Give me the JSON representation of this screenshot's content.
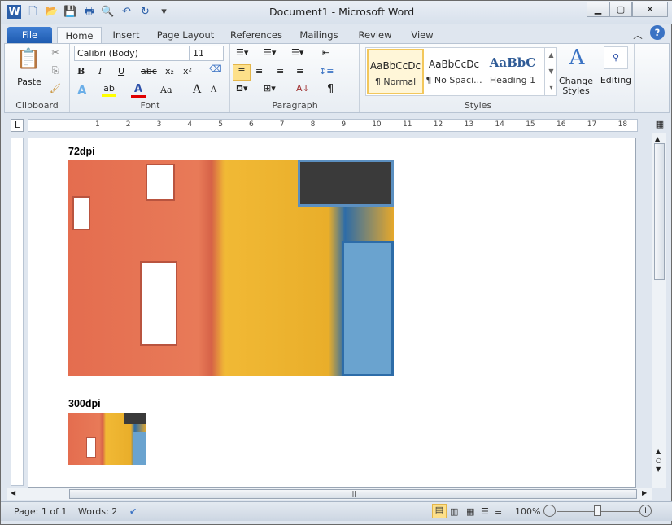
{
  "window": {
    "title": "Document1  -  Microsoft Word"
  },
  "qat": [
    "word-icon",
    "new-icon",
    "open-icon",
    "save-icon",
    "print-icon",
    "print-preview-icon",
    "undo-icon",
    "redo-icon",
    "customize-icon"
  ],
  "tabs": [
    "File",
    "Home",
    "Insert",
    "Page Layout",
    "References",
    "Mailings",
    "Review",
    "View"
  ],
  "ribbon": {
    "clipboard": {
      "label": "Clipboard",
      "paste": "Paste"
    },
    "font": {
      "label": "Font",
      "name": "Calibri (Body)",
      "size": "11",
      "buttons": [
        "B",
        "I",
        "U",
        "abc",
        "x₂",
        "x²"
      ],
      "grow": "A",
      "shrink": "A",
      "case": "Aa",
      "color_highlight": "#ffff00",
      "color_font": "#e00000"
    },
    "paragraph": {
      "label": "Paragraph",
      "pilcrow": "¶"
    },
    "styles": {
      "label": "Styles",
      "items": [
        {
          "sample": "AaBbCcDc",
          "name": "¶ Normal"
        },
        {
          "sample": "AaBbCcDc",
          "name": "¶ No Spaci..."
        },
        {
          "sample": "AaBbC",
          "name": "Heading 1"
        }
      ],
      "change": "Change Styles"
    },
    "editing": {
      "label": "Editing"
    }
  },
  "ruler": [
    "1",
    "2",
    "3",
    "4",
    "5",
    "6",
    "7",
    "8",
    "9",
    "10",
    "11",
    "12",
    "13",
    "14",
    "15",
    "16",
    "17",
    "18"
  ],
  "document": {
    "label1": "72dpi",
    "label2": "300dpi"
  },
  "status": {
    "page": "Page: 1 of 1",
    "words": "Words: 2",
    "zoom": "100%"
  }
}
